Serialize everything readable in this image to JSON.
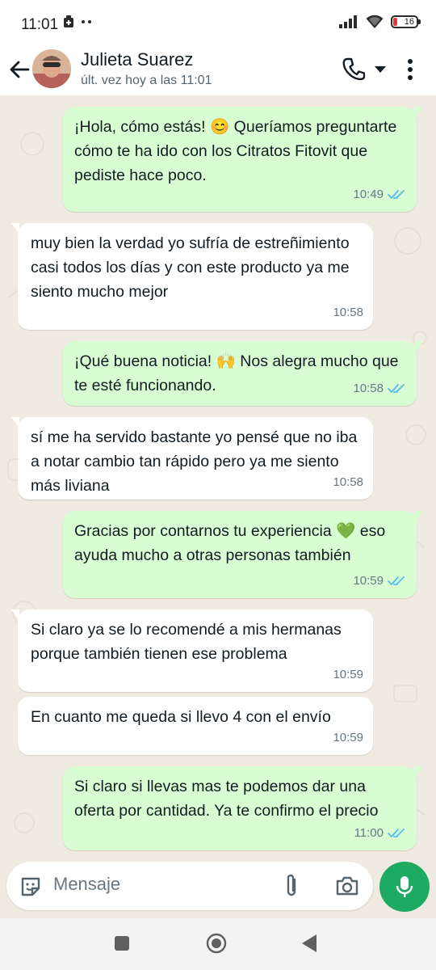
{
  "status_bar": {
    "time": "11:01",
    "battery_level": "16",
    "icons": [
      "notification-icon",
      "more-dots-icon",
      "signal-icon",
      "wifi-icon",
      "battery-icon"
    ]
  },
  "header": {
    "contact_name": "Julieta Suarez",
    "contact_status": "últ. vez hoy a las 11:01",
    "icons": [
      "back-arrow-icon",
      "avatar",
      "phone-icon",
      "caret-down-icon",
      "more-vert-icon"
    ]
  },
  "messages": [
    {
      "direction": "out",
      "text": "¡Hola, cómo estás! 😊 Queríamos preguntarte cómo te ha ido con los Citratos Fitovit que pediste hace poco.",
      "time": "10:49",
      "read": true
    },
    {
      "direction": "in",
      "text": "muy bien la verdad yo sufría de estreñimiento casi todos los días y con este producto ya me siento mucho mejor",
      "time": "10:58"
    },
    {
      "direction": "out",
      "text": "¡Qué buena noticia! 🙌 Nos alegra mucho que te esté funcionando.",
      "time": "10:58",
      "read": true
    },
    {
      "direction": "in",
      "text": "sí me ha servido bastante yo pensé que no iba a notar cambio tan rápido pero ya me siento más liviana",
      "time": "10:58"
    },
    {
      "direction": "out",
      "text": "Gracias por contarnos tu experiencia 💚 eso ayuda mucho a otras personas también",
      "time": "10:59",
      "read": true
    },
    {
      "direction": "in",
      "text": "Si claro ya se lo recomendé a mis hermanas porque también tienen ese problema",
      "time": "10:59"
    },
    {
      "direction": "in",
      "text": "En cuanto me queda si llevo 4 con el envío",
      "time": "10:59"
    },
    {
      "direction": "out",
      "text": "Si claro si llevas mas te podemos dar una oferta por cantidad. Ya te confirmo el precio",
      "time": "11:00",
      "read": true
    }
  ],
  "composer": {
    "placeholder": "Mensaje",
    "icons": [
      "sticker-icon",
      "attach-clip-icon",
      "camera-icon",
      "mic-icon"
    ]
  },
  "colors": {
    "outgoing_bubble": "#d9fdd3",
    "incoming_bubble": "#ffffff",
    "chat_background": "#efeae2",
    "read_ticks": "#53bdeb",
    "mic_button": "#1daa61"
  }
}
